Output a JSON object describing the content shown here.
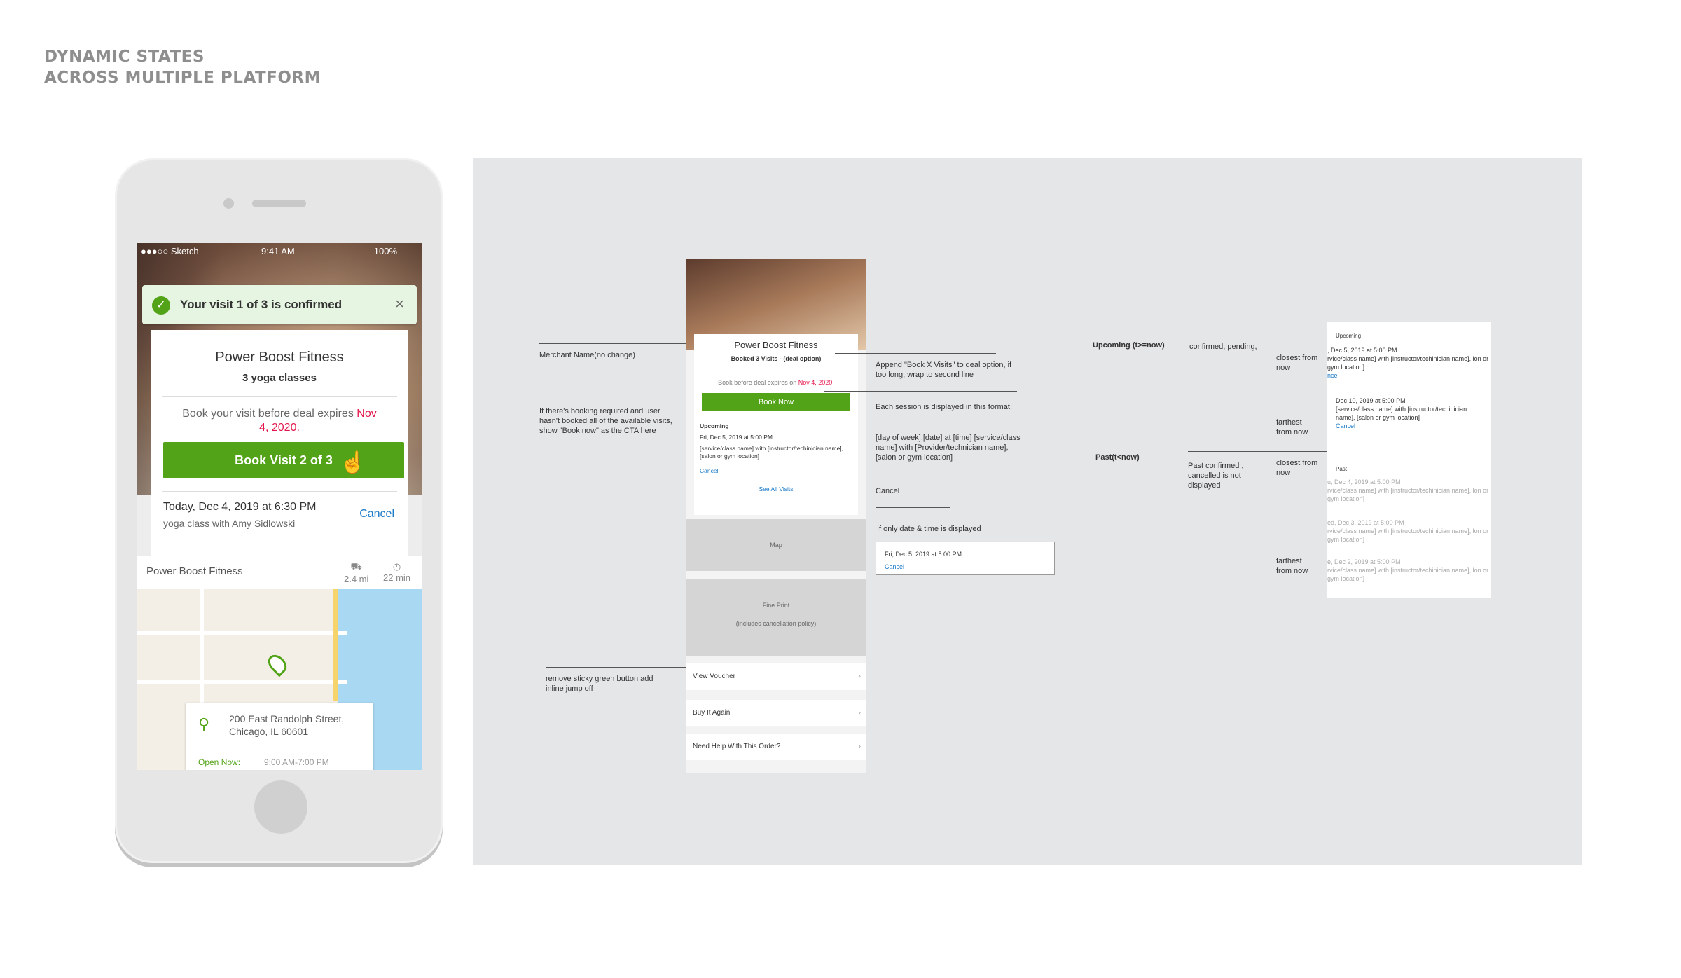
{
  "page": {
    "title_line1": "DYNAMIC STATES",
    "title_line2": "ACROSS MULTIPLE PLATFORM"
  },
  "phone": {
    "status": {
      "carrier": "●●●○○ Sketch",
      "time": "9:41 AM",
      "battery": "100%"
    },
    "toast": {
      "text": "Your visit 1 of 3  is confirmed",
      "close": "×",
      "check": "✓"
    },
    "deal": {
      "merchant": "Power Boost Fitness",
      "option": "3 yoga classes",
      "expire_prefix": "Book your visit before deal expires",
      "expire_date": "Nov 4, 2020",
      "expire_suffix": ".",
      "button": "Book Visit 2 of 3",
      "visit_date": "Today, Dec 4, 2019 at 6:30 PM",
      "visit_desc": "yoga class with Amy Sidlowski",
      "cancel": "Cancel"
    },
    "map": {
      "merchant": "Power Boost Fitness",
      "distance": "2.4 mi",
      "duration": "22 min",
      "address_line1": "200 East Randolph Street,",
      "address_line2": "Chicago, IL 60601",
      "open_label": "Open Now:",
      "hours": "9:00 AM-7:00 PM"
    }
  },
  "annotations": {
    "merchant_name": "Merchant Name(no change)",
    "book_now_note": "If there's booking required and user hasn't booked all of the available visits, show \"Book now\" as the CTA here",
    "remove_sticky": "remove sticky green button add inline jump off",
    "append_note": "Append \"Book X Visits\" to deal option, if too long, wrap to second line",
    "session_format": "Each session is displayed in this format:",
    "session_template": "[day of week],[date] at [time] [service/class name] with [Provider/technician name], [salon or gym location]",
    "session_cancel": "Cancel",
    "date_only_note": "If only date & time is displayed",
    "date_only_value": "Fri, Dec 5, 2019 at 5:00 PM",
    "date_only_cancel": "Cancel",
    "upcoming_label": "Upcoming (t>=now)",
    "upcoming_states": "confirmed, pending,",
    "past_label": "Past(t<now)",
    "past_states": "Past confirmed , cancelled is not displayed",
    "closest": "closest from now",
    "farthest": "farthest from now"
  },
  "mockup": {
    "merchant": "Power Boost Fitness",
    "option": "Booked 3 Visits - (deal option)",
    "expire_prefix": "Book before deal expires on",
    "expire_date": "Nov 4, 2020.",
    "button": "Book Now",
    "upcoming": "Upcoming",
    "session_date": "Fri, Dec 5, 2019 at 5:00 PM",
    "session_desc": "[service/class name] with [instructor/techinician name], [salon or gym location]",
    "cancel": "Cancel",
    "see_all": "See All Visits",
    "map": "Map",
    "fine_print": "Fine Print",
    "fine_print_note": "(includes cancellation policy)",
    "rows": [
      "View Voucher",
      "Buy It Again",
      "Need Help With This Order?"
    ]
  },
  "list": {
    "upcoming": "Upcoming",
    "past": "Past",
    "items": [
      {
        "date": ", Dec 5, 2019 at 5:00 PM",
        "desc": "rvice/class name] with [instructor/techinician name], lon or gym location]",
        "cancel": "ncel",
        "greyed": false
      },
      {
        "date": "Dec 10, 2019 at 5:00 PM",
        "desc": "[service/class name] with [instructor/techinician name], [salon or gym location]",
        "cancel": "Cancel",
        "greyed": false
      },
      {
        "date": "u, Dec 4, 2019 at 5:00 PM",
        "desc": "rvice/class name] with [instructor/techinician name], lon or gym location]",
        "cancel": "",
        "greyed": true
      },
      {
        "date": "ed, Dec 3, 2019 at 5:00 PM",
        "desc": "rvice/class name] with [instructor/techinician name], lon or gym location]",
        "cancel": "",
        "greyed": true
      },
      {
        "date": "e, Dec 2, 2019 at 5:00 PM",
        "desc": "rvice/class name] with [instructor/techinician name], lon or gym location]",
        "cancel": "",
        "greyed": true
      }
    ]
  }
}
